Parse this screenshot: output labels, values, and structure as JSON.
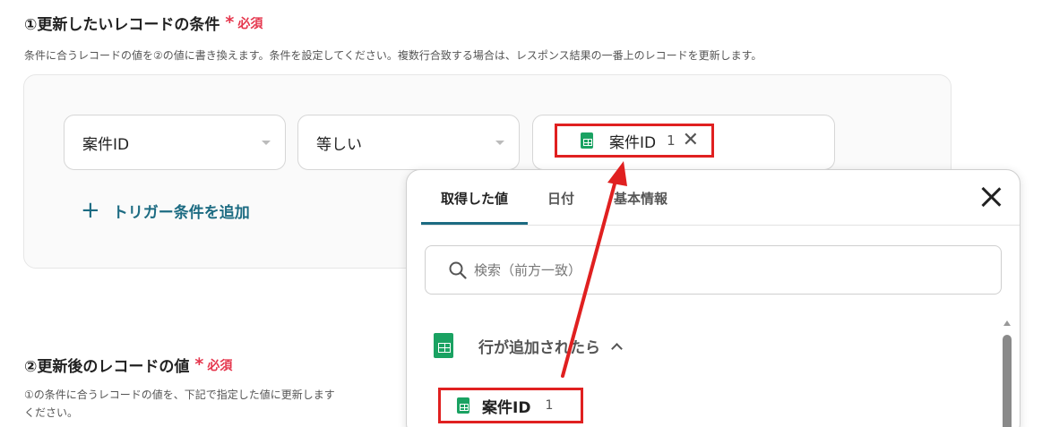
{
  "section1": {
    "title": "①更新したいレコードの条件",
    "required_star": "*",
    "required_label": "必須",
    "description": "条件に合うレコードの値を②の値に書き換えます。条件を設定してください。複数行合致する場合は、レスポンス結果の一番上のレコードを更新します。"
  },
  "condition": {
    "field_value": "案件ID",
    "operator_value": "等しい",
    "chip_label": "案件ID",
    "chip_num": "1",
    "add_trigger_label": "トリガー条件を追加"
  },
  "section2": {
    "title": "②更新後のレコードの値",
    "required_star": "*",
    "required_label": "必須",
    "description_line1": "①の条件に合うレコードの値を、下記で指定した値に更新します",
    "description_line2": "ください。"
  },
  "popup": {
    "tabs": [
      "取得した値",
      "日付",
      "基本情報"
    ],
    "search_placeholder": "検索（前方一致）",
    "group_label": "行が追加されたら",
    "item_label": "案件ID",
    "item_num": "1"
  },
  "colors": {
    "accent": "#1c6b82",
    "required": "#e5364d",
    "highlight": "#e02020",
    "sheets_green": "#1aa262"
  }
}
